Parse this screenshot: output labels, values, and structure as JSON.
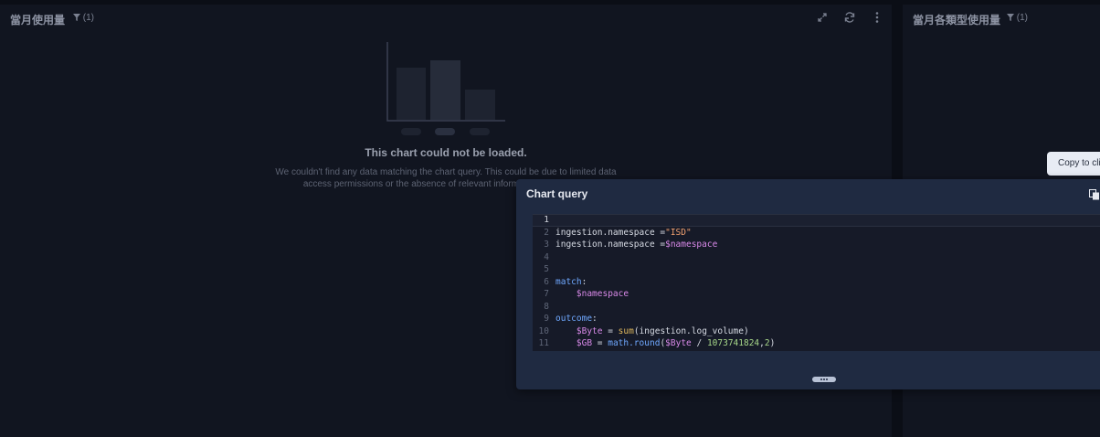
{
  "left_panel": {
    "title": "當月使用量",
    "filter_count": "(1)",
    "empty_title": "This chart could not be loaded.",
    "empty_description": "We couldn't find any data matching the chart query. This could be due to limited data access permissions or the absence of relevant information. F... criteria."
  },
  "right_panel": {
    "title": "當月各類型使用量",
    "filter_count": "(1)"
  },
  "tooltip": {
    "text": "Copy to cli"
  },
  "modal": {
    "title": "Chart query",
    "lines": [
      {
        "n": "1",
        "t": ""
      },
      {
        "n": "2",
        "t": "ingestion.namespace =\"ISD\""
      },
      {
        "n": "3",
        "t": "ingestion.namespace =$namespace"
      },
      {
        "n": "4",
        "t": ""
      },
      {
        "n": "5",
        "t": ""
      },
      {
        "n": "6",
        "t": "match:"
      },
      {
        "n": "7",
        "t": "    $namespace"
      },
      {
        "n": "8",
        "t": ""
      },
      {
        "n": "9",
        "t": "outcome:"
      },
      {
        "n": "10",
        "t": "    $Byte = sum(ingestion.log_volume)"
      },
      {
        "n": "11",
        "t": "    $GB = math.round($Byte / 1073741824,2)"
      }
    ]
  },
  "colors": {
    "background": "#0b0e16",
    "panel": "#111520",
    "modal": "#1f2a41",
    "code_bg": "#161a28"
  }
}
